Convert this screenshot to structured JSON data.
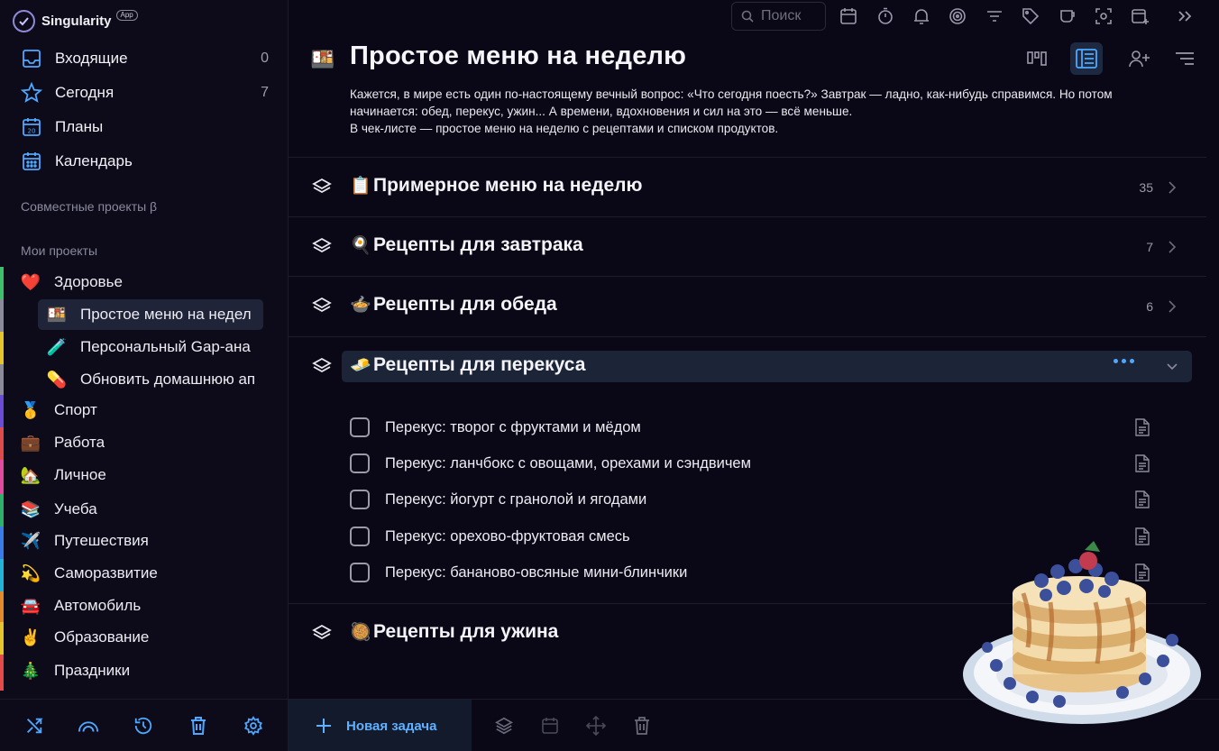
{
  "app": {
    "name": "Singularity",
    "badge": "App"
  },
  "nav": [
    {
      "label": "Входящие",
      "count": "0",
      "icon": "inbox-icon"
    },
    {
      "label": "Сегодня",
      "count": "7",
      "icon": "star-icon"
    },
    {
      "label": "Планы",
      "count": "",
      "icon": "calendar-20-icon"
    },
    {
      "label": "Календарь",
      "count": "",
      "icon": "calendar-grid-icon"
    }
  ],
  "sections": {
    "shared": "Совместные проекты β",
    "mine": "Мои проекты"
  },
  "projects": [
    {
      "emoji": "❤️",
      "label": "Здоровье",
      "bar": "#3fbf6a"
    },
    {
      "emoji": "🍱",
      "label": "Простое меню на недел",
      "sub": true,
      "active": true
    },
    {
      "emoji": "🧪",
      "label": "Персональный Gap-ана",
      "sub": true
    },
    {
      "emoji": "💊",
      "label": "Обновить домашнюю ап",
      "sub": true
    },
    {
      "emoji": "🥇",
      "label": "Спорт",
      "bar": "#6b4cd6"
    },
    {
      "emoji": "💼",
      "label": "Работа",
      "bar": "#e04a4a"
    },
    {
      "emoji": "🏡",
      "label": "Личное",
      "bar": "#e24aa0"
    },
    {
      "emoji": "📚",
      "label": "Учеба",
      "bar": "#2fb06a"
    },
    {
      "emoji": "✈️",
      "label": "Путешествия",
      "bar": "#3a7bea"
    },
    {
      "emoji": "💫",
      "label": "Саморазвитие",
      "bar": "#20b5d8"
    },
    {
      "emoji": "🚘",
      "label": "Автомобиль",
      "bar": "#e58a2a"
    },
    {
      "emoji": "✌️",
      "label": "Образование",
      "bar": "#e5c52a"
    },
    {
      "emoji": "🎄",
      "label": "Праздники",
      "bar": "#e54a4a"
    }
  ],
  "search": {
    "placeholder": "Поиск"
  },
  "page": {
    "emoji": "🍱",
    "title": "Простое меню на неделю",
    "desc_line1": "Кажется, в мире есть один по-настоящему вечный вопрос: «Что сегодня поесть?» Завтрак — ладно, как-нибудь справимся. Но потом",
    "desc_line2": "начинается: обед, перекус, ужин... А времени, вдохновения и сил на это — всё меньше.",
    "desc_line3": "В чек-листе — простое меню на неделю с рецептами и списком продуктов."
  },
  "groups": [
    {
      "emoji": "📋",
      "title": "Примерное меню на неделю",
      "count": "35"
    },
    {
      "emoji": "🍳",
      "title": "Рецепты для завтрака",
      "count": "7"
    },
    {
      "emoji": "🍲",
      "title": "Рецепты для обеда",
      "count": "6"
    },
    {
      "emoji": "🧈",
      "title": "Рецепты для перекуса",
      "count": ""
    },
    {
      "emoji": "🥘",
      "title": "Рецепты для ужина",
      "count": ""
    }
  ],
  "tasks": [
    "Перекус: творог с фруктами и мёдом",
    "Перекус: ланчбокс с овощами, орехами и сэндвичем",
    "Перекус: йогурт с гранолой и ягодами",
    "Перекус: орехово-фруктовая смесь",
    "Перекус: бананово-овсяные мини-блинчики"
  ],
  "bottom": {
    "new_task": "Новая задача"
  },
  "colors": {
    "accent": "#4ea8ff",
    "background": "#0a0816",
    "sidebar": "#0d0b1a"
  }
}
